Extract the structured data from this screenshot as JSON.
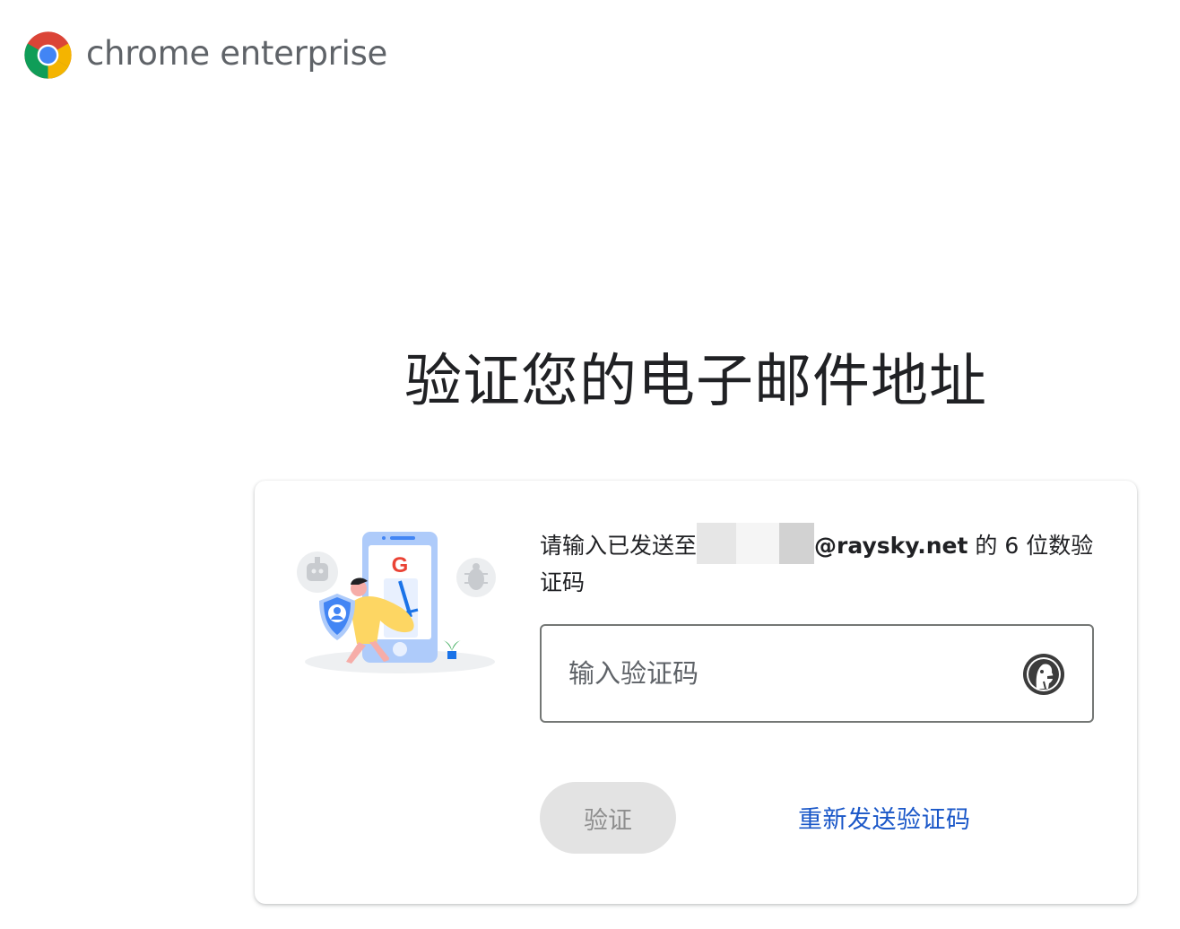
{
  "brand": {
    "name": "chrome enterprise"
  },
  "page": {
    "title": "验证您的电子邮件地址"
  },
  "card": {
    "description_prefix": "请输入已发送至",
    "email_domain": "@raysky.net",
    "description_suffix": " 的 6 位数验证码",
    "code_input": {
      "placeholder": "输入验证码",
      "value": ""
    },
    "verify_button": {
      "label": "验证",
      "disabled": true
    },
    "resend_link": {
      "label": "重新发送验证码"
    }
  },
  "icons": {
    "logo": "chrome-logo-icon",
    "input_extension": "duckduckgo-icon",
    "illustration": "security-verification-illustration"
  },
  "colors": {
    "link": "#1a57c8",
    "button_disabled_bg": "#e3e3e3",
    "button_disabled_text": "#8e8e8e",
    "field_border": "#747775"
  }
}
